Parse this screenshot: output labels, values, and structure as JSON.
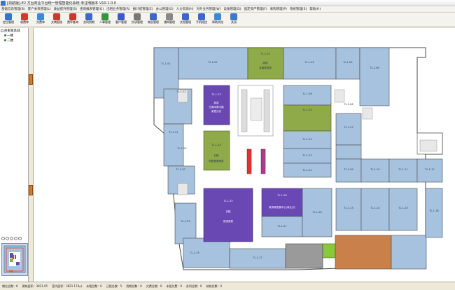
{
  "window": {
    "title": "[领航版]-E2  方台商业平台统一管理智能化系统  未注明版本 V10.1.0.0"
  },
  "menus": [
    "基础信息管理(B)",
    "客户关系管理(L)",
    "收益提升管理(S)",
    "查询报表管理(Q)",
    "出租业务管理(R)",
    "报计提管理(E)",
    "办公管理(O)",
    "人力资源(H)",
    "对外业务管理(W)",
    "设备管理(D)",
    "固定资产管理(F)",
    "采购管理(P)",
    "系统管理(S)",
    "帮助(H)"
  ],
  "toolbar": [
    {
      "label": "定位管理",
      "icon": "locate-icon",
      "color": "#2e78c8"
    },
    {
      "label": "收费单",
      "icon": "bill-icon",
      "color": "#d43a2a"
    },
    {
      "label": "欠费单",
      "icon": "arrears-icon",
      "color": "#3a8ad6"
    },
    {
      "label": "文商报账",
      "icon": "report-icon",
      "color": "#c83a2a"
    },
    {
      "label": "费率查询",
      "icon": "rate-icon",
      "color": "#c83a2a"
    },
    {
      "label": "合同到期",
      "icon": "contract-icon",
      "color": "#3a6ac8"
    },
    {
      "label": "人事管理",
      "icon": "person-icon",
      "color": "#2e9a3a"
    },
    {
      "label": "客户管理",
      "icon": "customer-icon",
      "color": "#3a5ac8"
    },
    {
      "label": "抄读管理",
      "icon": "meter-icon",
      "color": "#777777"
    },
    {
      "label": "物业管理",
      "icon": "property-icon",
      "color": "#3a6ac8"
    },
    {
      "label": "通知管理",
      "icon": "notice-icon",
      "color": "#888888"
    },
    {
      "label": "文档管理",
      "icon": "document-icon",
      "color": "#3a6ac8"
    },
    {
      "label": "手机短信",
      "icon": "sms-icon",
      "color": "#3a6ac8"
    },
    {
      "label": "帮助文档",
      "icon": "help-icon",
      "color": "#3a8ad6"
    },
    {
      "label": "关闭",
      "icon": "close-icon",
      "color": "#3a7ac8"
    }
  ],
  "tree": {
    "root": "商家家具城",
    "children": [
      "一楼",
      "二楼"
    ]
  },
  "floorplan": {
    "rooms": [
      {
        "id": "TL-1-1",
        "label": "TL-1-01"
      },
      {
        "id": "TL-1-2",
        "label": "TL-1-02"
      },
      {
        "id": "TL-1-3",
        "label": "TL-1-03",
        "sub": [
          "商用",
          "富阁家居城"
        ]
      },
      {
        "id": "TL-1-4",
        "label": "TL-1-04"
      },
      {
        "id": "TL-1-5",
        "label": "TL-1-05"
      },
      {
        "id": "TL-1-6",
        "label": "TL-1-06"
      },
      {
        "id": "TL-1-22",
        "label": "TL-1-22"
      },
      {
        "id": "TL-1-23",
        "label": "TL-1-23",
        "sub": [
          "商用",
          "左阁木家中国",
          "家居分店"
        ]
      },
      {
        "id": "TL-1-24",
        "label": "TL-1-24",
        "sub": [
          "已租",
          "阳阳盛家家居"
        ]
      },
      {
        "id": "TL-1-25",
        "label": "TL-1-25",
        "sub": [
          "已租",
          "阳宝家居"
        ]
      },
      {
        "id": "TL-1-26",
        "label": "TL-1-26",
        "sub": [
          "家具城发展中心(商业)分"
        ]
      },
      {
        "id": "TL-1-27",
        "label": "TL-1-27"
      },
      {
        "id": "TL-1-28",
        "label": "TL-1-28"
      },
      {
        "id": "TL-1-29",
        "label": "TL-1-29"
      },
      {
        "id": "TL-1-30",
        "label": "TL-1-30"
      },
      {
        "id": "TL-1-21",
        "label": "TL-1-21"
      },
      {
        "id": "TL-1-20",
        "label": "TL-1-20"
      },
      {
        "id": "TL-1-19",
        "label": "TL-1-19"
      },
      {
        "id": "TL-1-18",
        "label": "TL-1-18"
      },
      {
        "id": "TL-1-17",
        "label": "TL-1-17"
      },
      {
        "id": "TL-1-16",
        "label": "TL-1-16"
      },
      {
        "id": "TL-1-15",
        "label": "TL-1-15"
      },
      {
        "id": "TL-1-14",
        "label": "TL-1-14"
      },
      {
        "id": "TL-1-13",
        "label": "TL-1-13"
      },
      {
        "id": "TL-1-12",
        "label": "TL-1-12"
      },
      {
        "id": "TL-1-11",
        "label": "TL-1-11"
      },
      {
        "id": "TL-1-10",
        "label": "TL-1-10"
      },
      {
        "id": "TL-1-09",
        "label": "TL-1-09"
      },
      {
        "id": "TL-1-08",
        "label": "TL-1-08"
      },
      {
        "id": "TL-1-07",
        "label": "TL-1-07"
      },
      {
        "id": "TL-1-35",
        "label": "TL-1-35"
      },
      {
        "id": "TL-1-36",
        "label": "TL-1-36"
      },
      {
        "id": "TL-1-33",
        "label": "TL-1-33"
      },
      {
        "id": "TL-1-34",
        "label": "TL-1-34"
      },
      {
        "id": "TL-1-31",
        "label": "TL-1-31"
      },
      {
        "id": "TL-1-32",
        "label": "TL-1-32"
      },
      {
        "id": "TL-1-37",
        "label": "TL-1-37"
      },
      {
        "id": "TL-1-38",
        "label": "TL-1-38"
      }
    ],
    "colors": {
      "vacant": "#a7c2de",
      "leased_purple": "#6a48b4",
      "leased_olive": "#8faa48",
      "corridor": "#ffffff",
      "wall": "#4a4a4a",
      "orange": "#c9804a"
    }
  },
  "statusbar": [
    "铺位总数：6",
    "建筑面积：3821.05",
    "室内面积：3821.174㎡",
    "未租总数：0",
    "已租总数：5",
    "到期总数：0",
    "欠费总数：0",
    "未租欠费：0",
    "合同总数：0",
    "装修总数：0"
  ]
}
